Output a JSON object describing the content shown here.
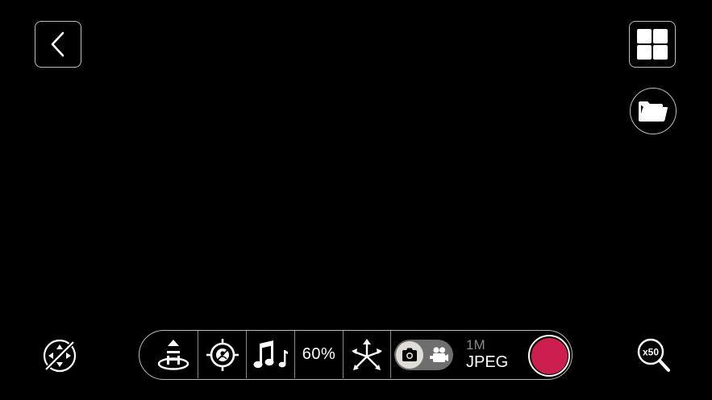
{
  "colors": {
    "background": "#000000",
    "border": "#bdbdbd",
    "record": "#cc1f4f",
    "toggle_track": "#6e6e6e",
    "toggle_knob": "#e0dcd8",
    "muted_text": "#8a8a8a"
  },
  "top_left": {
    "icon": "chevron-left-icon"
  },
  "top_right": {
    "gallery_icon": "grid-icon",
    "files_icon": "folder-icon"
  },
  "bottom_left": {
    "icon": "gimbal-recenter-icon"
  },
  "bottom_right": {
    "zoom_label": "x50",
    "icon": "magnifier-icon"
  },
  "toolbar": {
    "items": [
      {
        "icon": "horizon-calibrate-icon"
      },
      {
        "icon": "target-tracking-icon"
      },
      {
        "icon": "music-notes-icon"
      },
      {
        "label": "60%"
      },
      {
        "icon": "motion-arrows-icon"
      }
    ],
    "mode_toggle": {
      "selected": "photo",
      "photo_icon": "camera-icon",
      "video_icon": "movie-camera-icon"
    },
    "format": {
      "resolution": "1M",
      "type": "JPEG"
    },
    "shutter": {
      "icon": "record-button"
    }
  }
}
